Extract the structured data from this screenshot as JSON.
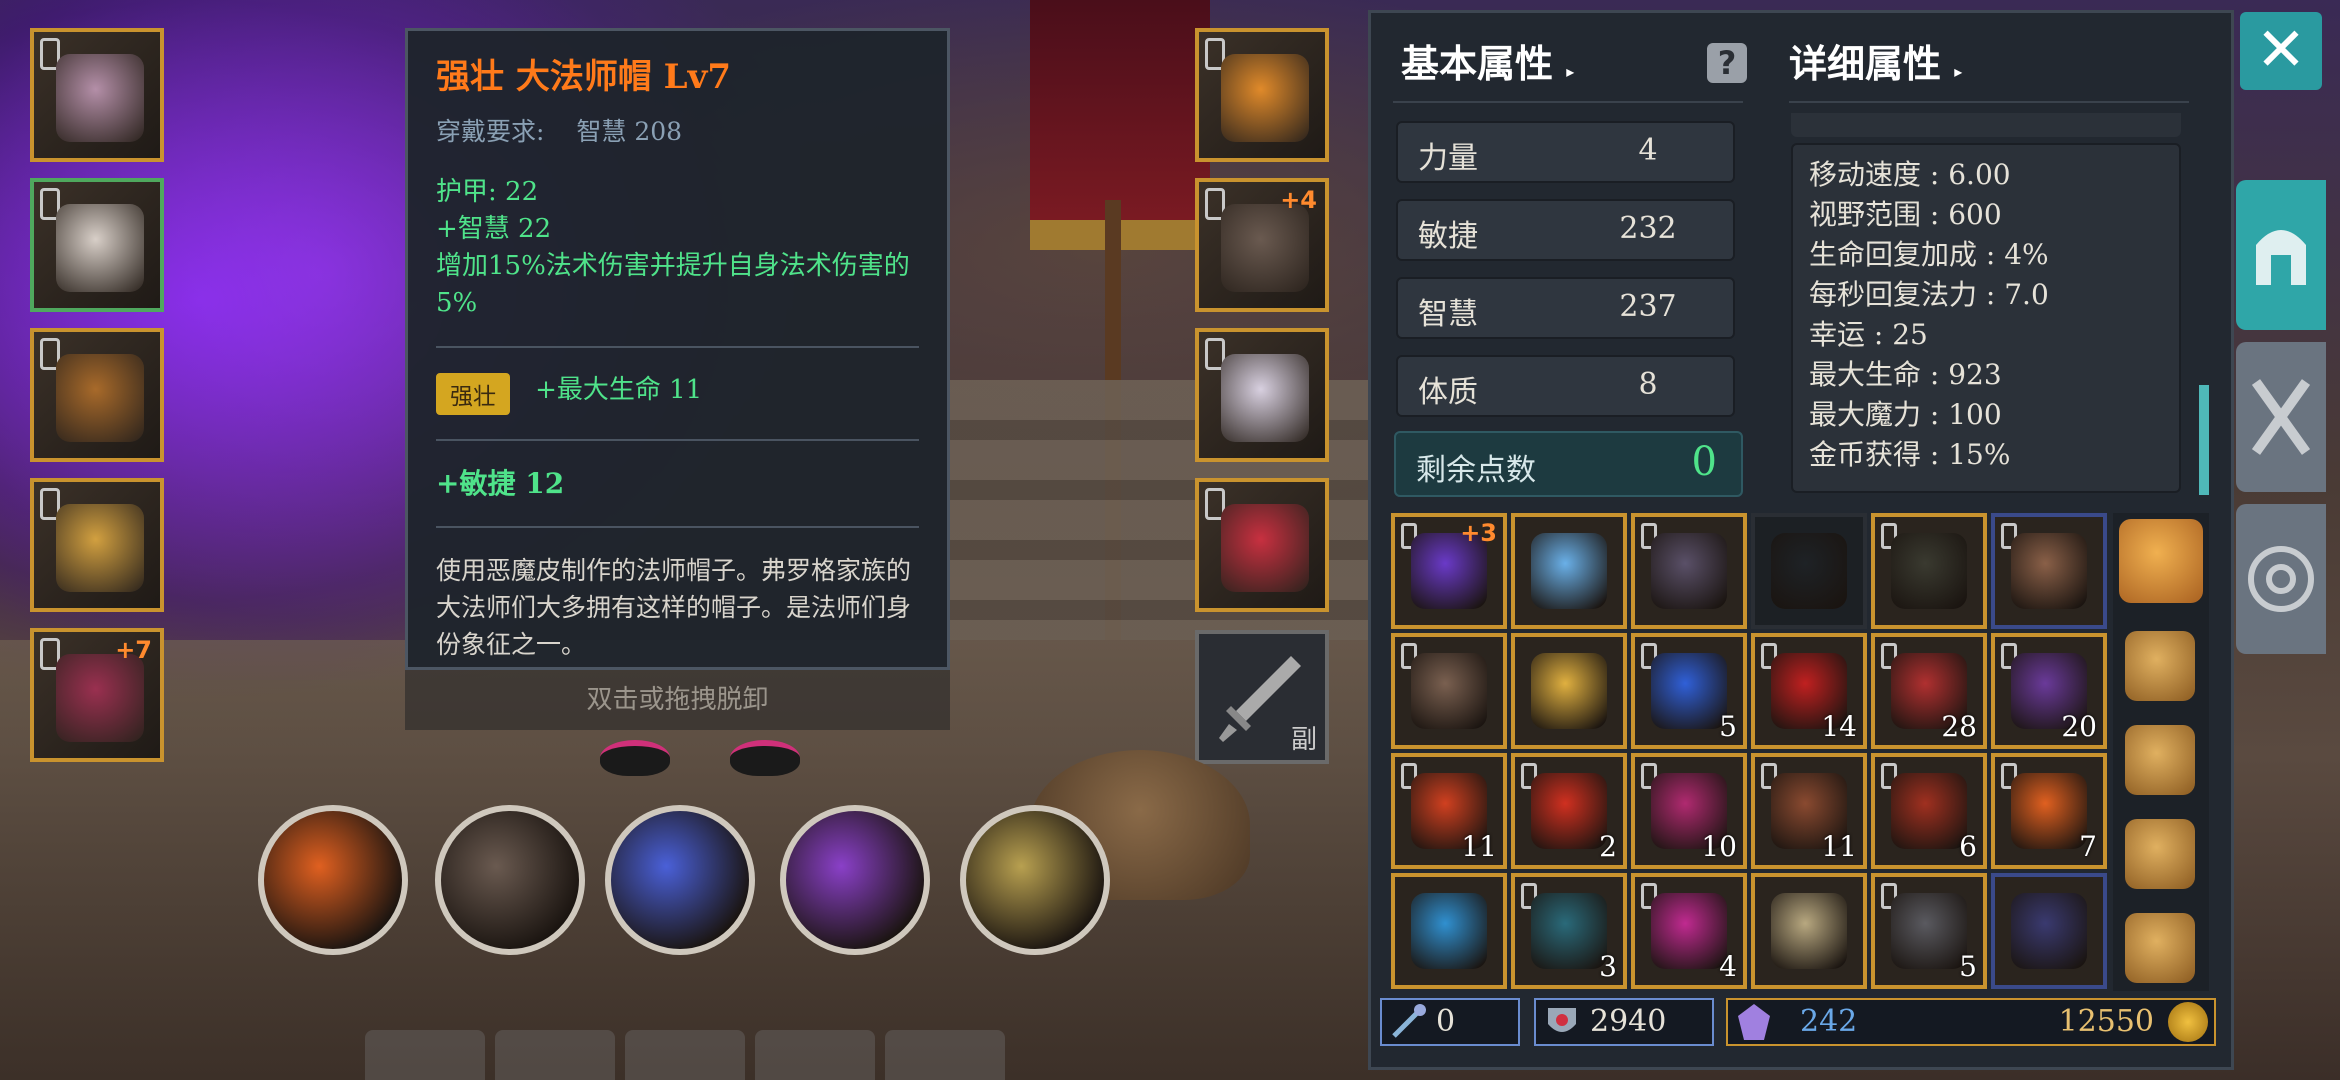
{
  "tooltip": {
    "title": "强壮  大法师帽  Lv7",
    "req_label": "穿戴要求:",
    "req_value": "智慧  208",
    "armor": "护甲:   22",
    "wis": "+智慧  22",
    "effect": "增加15%法术伤害并提升自身法术伤害的5%",
    "affix_badge": "强壮",
    "affix_stat": "+最大生命  11",
    "extra_stat": "+敏捷  12",
    "description": "使用恶魔皮制作的法师帽子。弗罗格家族的大法师们大多拥有这样的帽子。是法师们身份象征之一。",
    "unequip_hint": "双击或拖拽脱卸"
  },
  "left_slots": [
    {
      "name": "head",
      "color": "#b48fa8",
      "border": "gold",
      "plus": ""
    },
    {
      "name": "chest",
      "color": "#d8cfc8",
      "border": "green",
      "plus": ""
    },
    {
      "name": "pants",
      "color": "#a86a2a",
      "border": "gold",
      "plus": ""
    },
    {
      "name": "ring",
      "color": "#d2a040",
      "border": "gold",
      "plus": ""
    },
    {
      "name": "weapon",
      "color": "#9a3050",
      "border": "gold",
      "plus": "+7"
    }
  ],
  "right_slots": [
    {
      "name": "necklace",
      "color": "#e08a2a",
      "plus": ""
    },
    {
      "name": "gloves",
      "color": "#6a5a50",
      "plus": "+4"
    },
    {
      "name": "boots",
      "color": "#d8d0e0",
      "plus": ""
    },
    {
      "name": "ring2",
      "color": "#c83040",
      "plus": ""
    }
  ],
  "offhand_label": "副",
  "skills": [
    {
      "name": "meteor",
      "color": "#e06020"
    },
    {
      "name": "claw",
      "color": "#6a5a50"
    },
    {
      "name": "lightning-orb",
      "color": "#4a60d8"
    },
    {
      "name": "comet",
      "color": "#8a40c8"
    },
    {
      "name": "arcane",
      "color": "#b8a050"
    }
  ],
  "panel": {
    "tab_basic": "基本属性",
    "tab_detail": "详细属性",
    "stats": [
      {
        "label": "力量",
        "value": "4"
      },
      {
        "label": "敏捷",
        "value": "232"
      },
      {
        "label": "智慧",
        "value": "237"
      },
      {
        "label": "体质",
        "value": "8"
      }
    ],
    "remain_label": "剩余点数",
    "remain_value": "0",
    "details": [
      "移动速度 : 6.00",
      "视野范围 : 600",
      "生命回复加成 : 4%",
      "每秒回复法力 : 7.0",
      "幸运 : 25",
      "最大生命 : 923",
      "最大魔力 : 100",
      "金币获得 : 15%"
    ]
  },
  "inventory": [
    {
      "color": "#6a3ac8",
      "count": "",
      "up": "+3",
      "lock": true
    },
    {
      "color": "#6ab0e8",
      "count": "",
      "up": "",
      "lock": false
    },
    {
      "color": "#5a5068",
      "count": "",
      "up": "",
      "lock": true
    },
    {
      "color": "#1e2226",
      "count": "",
      "up": "",
      "lock": false
    },
    {
      "color": "#3a3a30",
      "count": "",
      "up": "",
      "lock": true
    },
    {
      "color": "#8a6048",
      "count": "",
      "up": "",
      "lock": true
    },
    {
      "color": "#7a6050",
      "count": "",
      "up": "",
      "lock": true
    },
    {
      "color": "#e0b040",
      "count": "",
      "up": "",
      "lock": false
    },
    {
      "color": "#3060d8",
      "count": "5",
      "up": "",
      "lock": true
    },
    {
      "color": "#c02020",
      "count": "14",
      "up": "",
      "lock": true
    },
    {
      "color": "#b03030",
      "count": "28",
      "up": "",
      "lock": true
    },
    {
      "color": "#6a3a9a",
      "count": "20",
      "up": "",
      "lock": true
    },
    {
      "color": "#d04020",
      "count": "11",
      "up": "",
      "lock": true
    },
    {
      "color": "#d03020",
      "count": "2",
      "up": "",
      "lock": true
    },
    {
      "color": "#b02a70",
      "count": "10",
      "up": "",
      "lock": true
    },
    {
      "color": "#8a4a30",
      "count": "11",
      "up": "",
      "lock": true
    },
    {
      "color": "#a03020",
      "count": "6",
      "up": "",
      "lock": true
    },
    {
      "color": "#e06020",
      "count": "7",
      "up": "",
      "lock": true
    },
    {
      "color": "#3090d0",
      "count": "",
      "up": "",
      "lock": false
    },
    {
      "color": "#2a6a7a",
      "count": "3",
      "up": "",
      "lock": true
    },
    {
      "color": "#c02a90",
      "count": "4",
      "up": "",
      "lock": true
    },
    {
      "color": "#b8a880",
      "count": "",
      "up": "",
      "lock": false
    },
    {
      "color": "#5a5a60",
      "count": "5",
      "up": "",
      "lock": true
    },
    {
      "color": "#3a3a70",
      "count": "",
      "up": "",
      "lock": false
    }
  ],
  "currency": {
    "gems": "0",
    "hearts": "2940",
    "crystals": "242",
    "gold": "12550"
  },
  "colors": {
    "gold_border": "#c9932e",
    "accent": "#2fa6a8",
    "tooltip_title": "#ff7a1a",
    "green_text": "#4fe38a"
  }
}
